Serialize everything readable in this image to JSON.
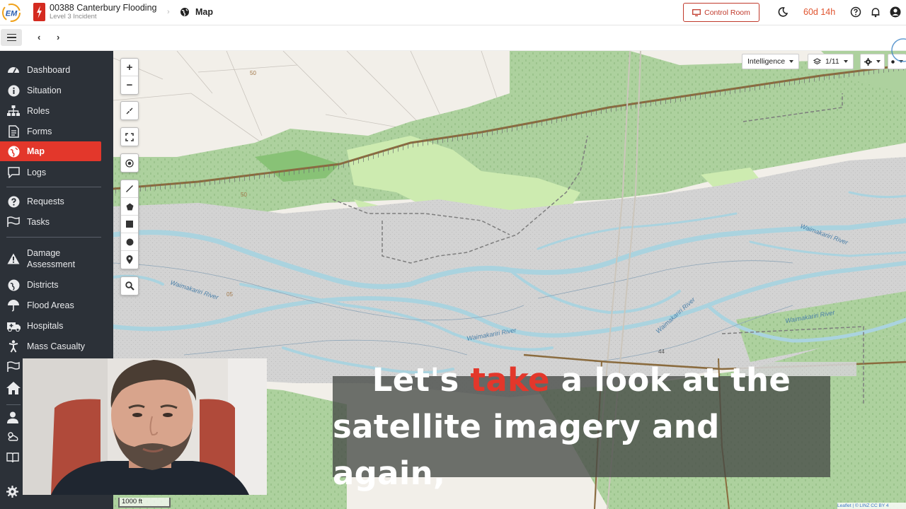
{
  "header": {
    "logo_text": "EM",
    "incident_title": "00388 Canterbury Flooding",
    "incident_subtitle": "Level 3 Incident",
    "breadcrumb_separator": "›",
    "page_title": "Map",
    "control_room_label": "Control Room",
    "timer": "60d 14h"
  },
  "toolbar": {
    "back_label": "‹",
    "forward_label": "›"
  },
  "sidebar": {
    "items": [
      {
        "label": "Dashboard",
        "icon": "dashboard-icon"
      },
      {
        "label": "Situation",
        "icon": "info-icon"
      },
      {
        "label": "Roles",
        "icon": "org-chart-icon"
      },
      {
        "label": "Forms",
        "icon": "form-icon"
      },
      {
        "label": "Map",
        "icon": "globe-icon",
        "active": true
      },
      {
        "label": "Logs",
        "icon": "chat-icon"
      },
      {
        "label": "Requests",
        "icon": "question-icon"
      },
      {
        "label": "Tasks",
        "icon": "flag-icon"
      },
      {
        "label": "Damage Assessment",
        "icon": "warning-icon"
      },
      {
        "label": "Districts",
        "icon": "globe-icon"
      },
      {
        "label": "Flood Areas",
        "icon": "umbrella-icon"
      },
      {
        "label": "Hospitals",
        "icon": "ambulance-icon"
      },
      {
        "label": "Mass Casualty",
        "icon": "person-icon"
      }
    ]
  },
  "map": {
    "zoom_in": "+",
    "zoom_out": "−",
    "layers_dropdown": "Intelligence",
    "layer_count": "1/11",
    "scale_label": "1000 ft",
    "attribution": "Leaflet | © LINZ CC BY 4",
    "labels": {
      "river_1": "Waimakariri River",
      "river_2": "Waimakariri River",
      "river_3": "Waimakariri River",
      "river_4": "Waimakariri River",
      "river_5": "Waimakariri River",
      "road_50a": "50",
      "road_50b": "50",
      "road_44": "44",
      "road_05": "05"
    }
  },
  "caption": {
    "line1_pre": "Let's ",
    "line1_highlight": "take",
    "line1_post": " a look at the",
    "line2": "satellite imagery and again,"
  },
  "colors": {
    "accent": "#e3372b",
    "sidebar_bg": "#2c3138",
    "timer": "#e0542f"
  }
}
